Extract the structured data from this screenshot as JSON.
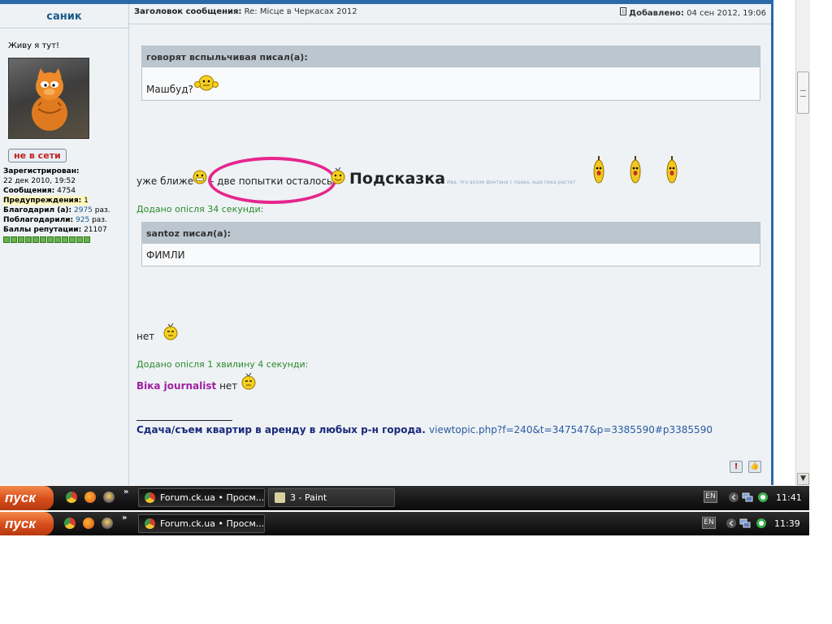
{
  "post": {
    "username": "саник",
    "subject_label": "Заголовок сообщения:",
    "subject": "Re: Місце в Черкасах 2012",
    "added_label": "Добавлено:",
    "added": "04 сен 2012, 19:06"
  },
  "profile": {
    "title": "Живу я тут!",
    "status": "не в сети",
    "registered_label": "Зарегистрирован:",
    "registered": "22 дек 2010, 19:52",
    "messages_label": "Сообщения:",
    "messages": "4754",
    "warnings_label": "Предупреждения:",
    "warnings": "1",
    "thanked_label": "Благодарил (а):",
    "thanked": "2975",
    "thanked_unit": "раз.",
    "got_thanks_label": "Поблагодарили:",
    "got_thanks": "925",
    "got_thanks_unit": "раз.",
    "reputation_label": "Баллы репутации:",
    "reputation": "21107"
  },
  "content": {
    "quote1_header": "говорят вспыльчивая писал(а):",
    "quote1_body": "Машбуд?",
    "line1_a": "уже ближе",
    "line1_b": "- две попытки осталось",
    "hint_word": "Подсказка",
    "hint_dash": "-",
    "hint_small": "Ива, что возле фонтана с права, еще пока растет",
    "added1": "Додано опісля 34 секунди:",
    "quote2_header": "santoz писал(а):",
    "quote2_body": "ФИМЛИ",
    "net1": "нет",
    "added2": "Додано опісля 1 хвилину 4 секунди:",
    "author": "Віка journalist",
    "net2": "нет",
    "signature": "Сдача/съем квартир в аренду в любых р-н города.",
    "signature_link": "viewtopic.php?f=240&t=347547&p=3385590#p3385590",
    "report_btn": "!",
    "thanks_btn": "👍"
  },
  "taskbar1": {
    "start": "пуск",
    "more": "»",
    "tasks": [
      "Forum.ck.ua • Просм...",
      "3 - Paint"
    ],
    "lang": "EN",
    "time": "11:41"
  },
  "taskbar2": {
    "start": "пуск",
    "more": "»",
    "tasks": [
      "Forum.ck.ua • Просм..."
    ],
    "lang": "EN",
    "time": "11:39"
  },
  "scrollbar": {
    "down_arrow": "▼"
  }
}
